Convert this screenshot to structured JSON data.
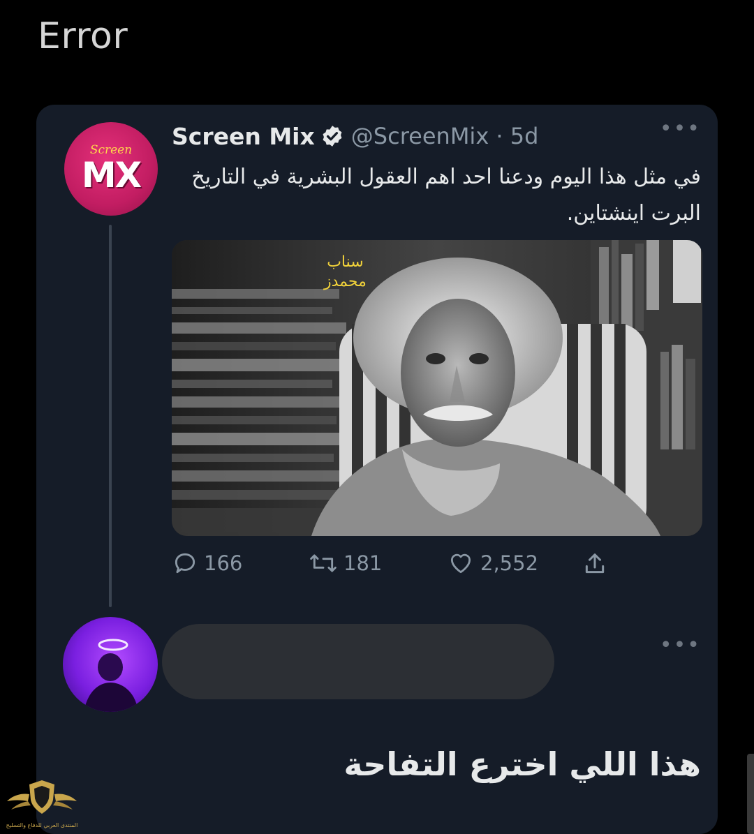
{
  "header": {
    "title": "Error"
  },
  "tweet": {
    "author_name": "Screen Mix",
    "handle": "@ScreenMix · 5d",
    "avatar_label": "MX",
    "avatar_script": "Screen",
    "text": "في مثل هذا اليوم ودعنا احد اهم العقول البشرية في التاريخ البرت اينشتاين.",
    "image_overlay": [
      "سناب",
      "محمدز"
    ],
    "actions": {
      "replies": "166",
      "retweets": "181",
      "likes": "2,552"
    }
  },
  "reply": {
    "text": "هذا اللي اخترع التفاحة"
  },
  "watermark": {
    "text": "المنتدى العربي للدفاع والتسليح"
  },
  "colors": {
    "background": "#000000",
    "card": "#151c28",
    "muted": "#8b98a5",
    "accent_pink": "#c21d62",
    "accent_purple": "#7a1fe0",
    "overlay_text": "#f1d23a"
  }
}
